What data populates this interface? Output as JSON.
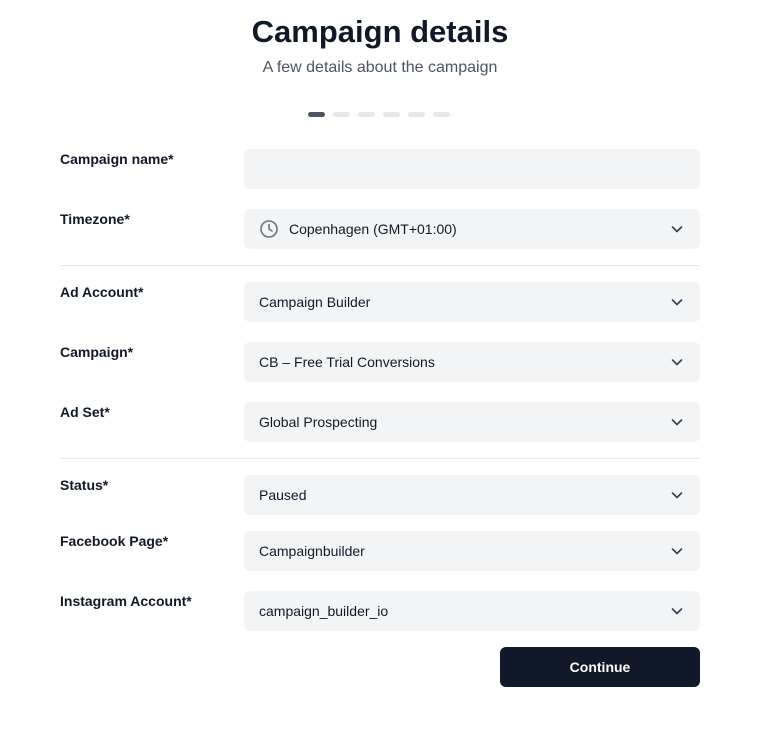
{
  "header": {
    "title": "Campaign details",
    "subtitle": "A few details about the campaign"
  },
  "stepper": {
    "total_steps": 6,
    "current_step": 1
  },
  "form": {
    "campaign_name": {
      "label": "Campaign name*",
      "value": "",
      "placeholder": ""
    },
    "timezone": {
      "label": "Timezone*",
      "value": "Copenhagen (GMT+01:00)",
      "icon": "clock-icon"
    },
    "ad_account": {
      "label": "Ad Account*",
      "value": "Campaign Builder"
    },
    "campaign": {
      "label": "Campaign*",
      "value": "CB – Free Trial Conversions"
    },
    "ad_set": {
      "label": "Ad Set*",
      "value": "Global Prospecting"
    },
    "status": {
      "label": "Status*",
      "value": "Paused"
    },
    "facebook_page": {
      "label": "Facebook Page*",
      "value": "Campaignbuilder"
    },
    "instagram_account": {
      "label": "Instagram Account*",
      "value": "campaign_builder_io"
    }
  },
  "actions": {
    "continue_label": "Continue"
  },
  "colors": {
    "primary": "#111827",
    "field_bg": "#f3f4f6",
    "muted_text": "#4b5563",
    "divider": "#e5e7eb"
  }
}
